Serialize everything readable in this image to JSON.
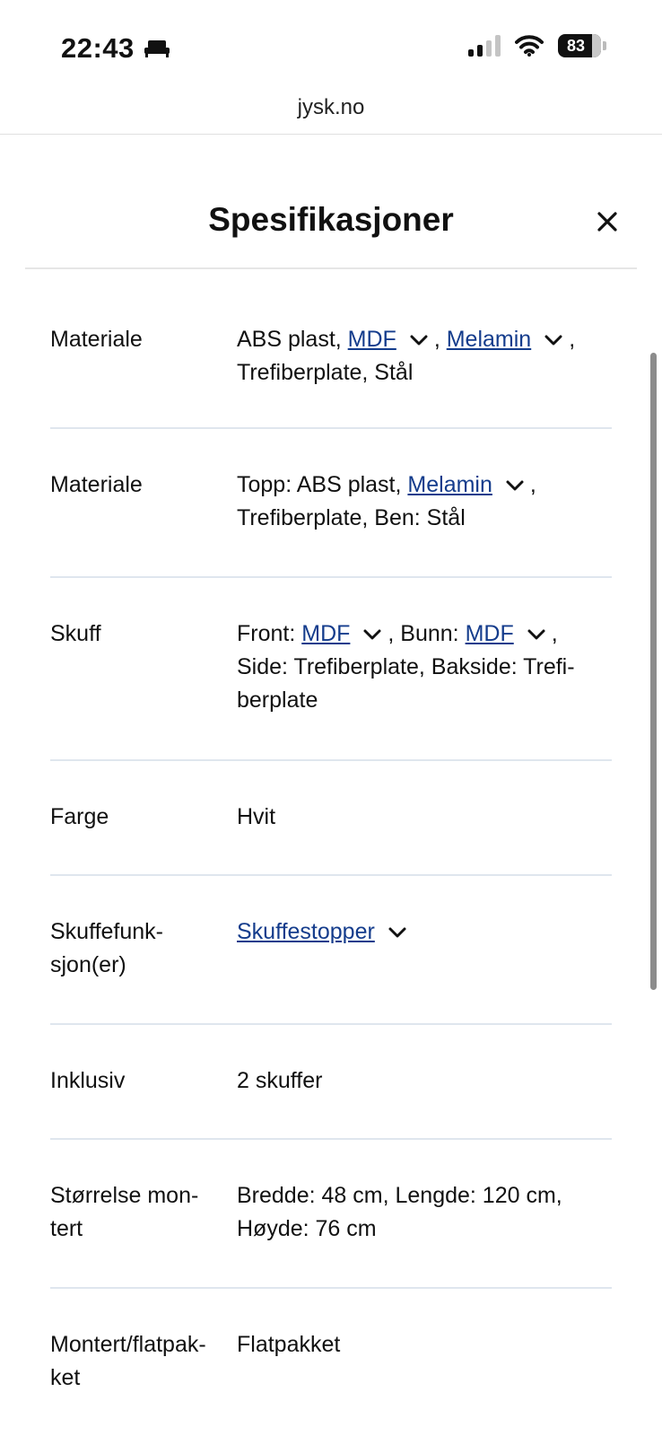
{
  "status_bar": {
    "time": "22:43",
    "battery_level": "83",
    "icons": [
      "bed-icon",
      "signal-icon",
      "wifi-icon",
      "battery-icon"
    ]
  },
  "browser": {
    "url": "jysk.no"
  },
  "sheet": {
    "title": "Spesifikasjoner",
    "rows": [
      {
        "label": "Materiale",
        "line1_a": "ABS plast, ",
        "link1": "MDF",
        "line1_b": ", ",
        "link2": "Melamin",
        "line1_c": ",",
        "line2": "Trefiberplate, Stål"
      },
      {
        "label": "Materiale",
        "line1_a": "Topp: ABS plast, ",
        "link1": "Melamin",
        "line1_b": ",",
        "line2": "Trefiberplate, Ben: Stål"
      },
      {
        "label": "Skuff",
        "line1_a": "Front: ",
        "link1": "MDF",
        "line1_b": ", Bunn: ",
        "link2": "MDF",
        "line1_c": ",",
        "line2": "Side: Trefiberplate, Bakside: Trefi-",
        "line3": "berplate"
      },
      {
        "label": "Farge",
        "value": "Hvit"
      },
      {
        "label_line1": "Skuffefunk-",
        "label_line2": "sjon(er)",
        "link1": "Skuffestopper"
      },
      {
        "label": "Inklusiv",
        "value": "2 skuffer"
      },
      {
        "label_line1": "Størrelse mon-",
        "label_line2": "tert",
        "line1": "Bredde: 48 cm, Lengde: 120 cm,",
        "line2": "Høyde: 76 cm"
      },
      {
        "label_line1": "Montert/flatpak-",
        "label_line2": "ket",
        "value": "Flatpakket"
      }
    ]
  },
  "colors": {
    "link": "#143c8c",
    "divider": "#dfe6ee",
    "text": "#111111"
  }
}
